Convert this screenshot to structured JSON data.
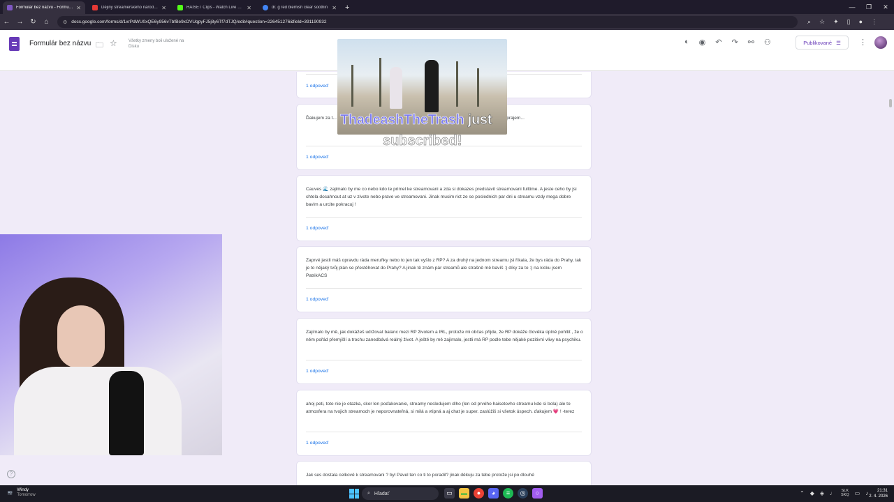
{
  "browser": {
    "tabs": [
      {
        "title": "Formulár bez názvu - Formulár",
        "color": "#7e57c2",
        "active": true
      },
      {
        "title": "Dějiny streamerského národa u",
        "color": "#e53935",
        "active": false
      },
      {
        "title": "HAISET Clips - Watch Live on K",
        "color": "#53fc18",
        "active": false
      },
      {
        "title": "dr. g red blemish clear soothin",
        "color": "#4285f4",
        "active": false
      }
    ],
    "new_tab": "+",
    "url": "docs.google.com/forms/d/1xrPdWU0xQE6y956vTbfBe9xOVUqpyFJ5j8y6Tf7dTJQ/edit#question=226451276&field=391190932"
  },
  "form_header": {
    "title": "Formulár bez názvu",
    "save_status": "Všetky zmeny boli uložené na Disku",
    "publish_label": "Publikované"
  },
  "responses": [
    {
      "text": "",
      "count": "1 odpoveď"
    },
    {
      "text": "Ďakujem za t... v práci, keď som prišiel domov vyčerpaný, d... deš ešte dlho takto zlepšovať deň a prajem...",
      "count": "1 odpoveď"
    },
    {
      "text": "Cauves 🌊 zajimalo by me co nebo kdo te primel ke streamovani a zda si dokazes predstavit streamovani fulltime. A jeste ceho by jsi chtela dosahnout at uz v zivote nebo prave ve streamovani. Jinak musim rict ze se poslednich par dni u streamu vzdy mega dobre bavim a urcite pokracuj !",
      "count": "1 odpoveď"
    },
    {
      "text": "Zaprvé jestli máš opravdu ráda meruňky nebo to jen tak vyšlo z RP? A za druhý na jednom streamu jsi říkala, že bys ráda do Prahy, tak je to nějaký tvůj plán se přestěhovat do Prahy? A jinak tě znám pár streamů ale strašně mě bavíš :) díky za to :) na kicku jsem PatrikACS",
      "count": "1 odpoveď"
    },
    {
      "text": "Zajímalo by mě, jak dokážeš udržovat balanc mezi RP životem a IRL, protože mi občas přijde, že RP dokáže člověka úplně pohltit , že o něm pořád přemýšlí a trochu zanedbává reálný život. A ještě by mě zajímalo, jestli má RP podle tebe nějaké pozitivní vlivy na psychiku.",
      "count": "1 odpoveď"
    },
    {
      "text": "ahoj peti, toto nie je otazka, skor len poďakovanie, streamy nesledujem dlho (len od prvého haisetovho streamu kde si bola) ale to atmosfera na tvojich streamoch je neporovnateľná, si milá a vtipná a aj chat je super. zaslúžiš si všetok úspech. ďakujem 💗 ! -terez",
      "count": "1 odpoveď"
    },
    {
      "text": "Jak ses dostala celkově k streamovani ? byl Pavel ten co ti to poradil? jinak děkuju za tebe protože jsi po dlouhé",
      "count": ""
    }
  ],
  "alert": {
    "name": "ThadeashTheTrash",
    "just": "just",
    "subscribed": "subscribed!"
  },
  "taskbar": {
    "weather_title": "Windy",
    "weather_sub": "Tomorrow",
    "search_placeholder": "Hľadať",
    "lang_top": "SLK",
    "lang_bottom": "SKQ",
    "time": "21:31",
    "date": "2. 4. 2026"
  },
  "colors": {
    "accent": "#673ab7",
    "link": "#1a73e8",
    "background": "#f0ebf8"
  }
}
